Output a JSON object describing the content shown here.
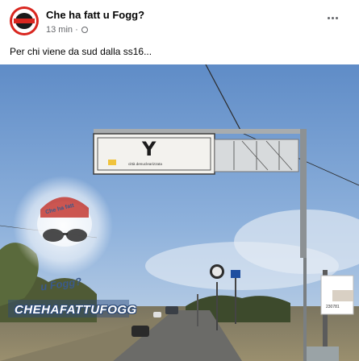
{
  "post": {
    "page_name": "Che ha fatt u Fogg?",
    "time": "13 min",
    "separator": "·",
    "privacy_icon": "globe-icon",
    "more_icon": "ellipsis-icon",
    "caption": "Per chi viene da sud dalla ss16..."
  },
  "photo": {
    "sign_letter": "Y",
    "sign_subtitle": "città denuclearizzata",
    "watermark_title": "Che ha fatt",
    "watermark_city": "u Fogg?",
    "watermark_banner": "CHEHAFATTUFOGG",
    "pole_number": "230781"
  }
}
